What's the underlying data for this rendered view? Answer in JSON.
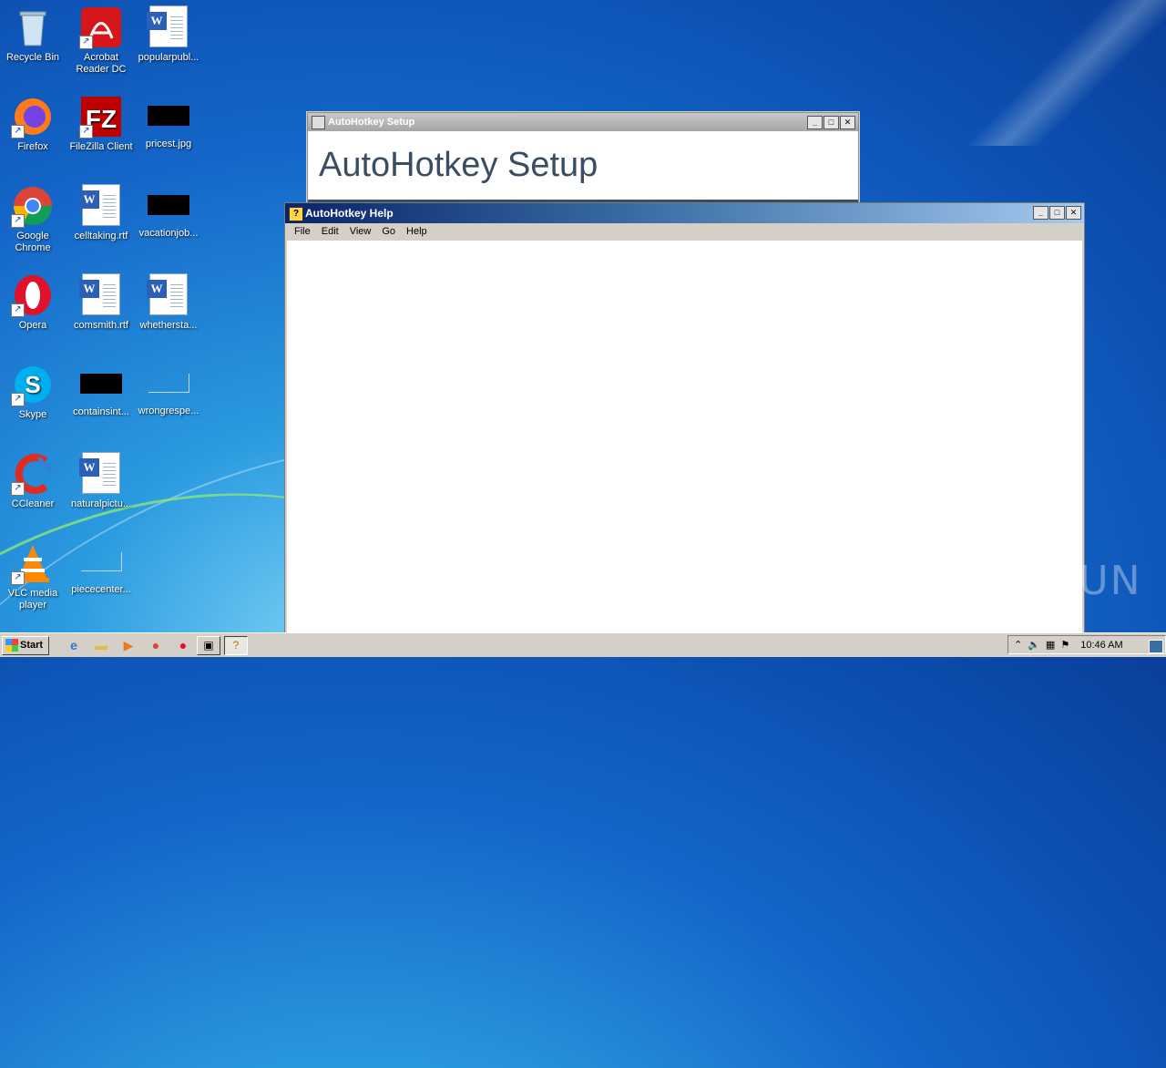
{
  "desktop": {
    "icons": [
      {
        "label": "Recycle Bin"
      },
      {
        "label": "Acrobat Reader DC"
      },
      {
        "label": "popularpubl..."
      },
      {
        "label": "Firefox"
      },
      {
        "label": "FileZilla Client"
      },
      {
        "label": "pricest.jpg"
      },
      {
        "label": "Google Chrome"
      },
      {
        "label": "celltaking.rtf"
      },
      {
        "label": "vacationjob..."
      },
      {
        "label": "Opera"
      },
      {
        "label": "comsmith.rtf"
      },
      {
        "label": "whethersta..."
      },
      {
        "label": "Skype"
      },
      {
        "label": "containsint..."
      },
      {
        "label": "wrongrespe..."
      },
      {
        "label": "CCleaner"
      },
      {
        "label": "naturalpictu..."
      },
      {
        "label": "VLC media player"
      },
      {
        "label": "piececenter..."
      }
    ]
  },
  "setup_window": {
    "title": "AutoHotkey Setup",
    "heading": "AutoHotkey Setup"
  },
  "help_window": {
    "title": "AutoHotkey Help",
    "menu": [
      "File",
      "Edit",
      "View",
      "Go",
      "Help"
    ]
  },
  "window_controls": {
    "minimize": "_",
    "maximize": "□",
    "close": "✕"
  },
  "taskbar": {
    "start_label": "Start",
    "clock": "10:46 AM"
  },
  "watermark": "ANY RUN"
}
